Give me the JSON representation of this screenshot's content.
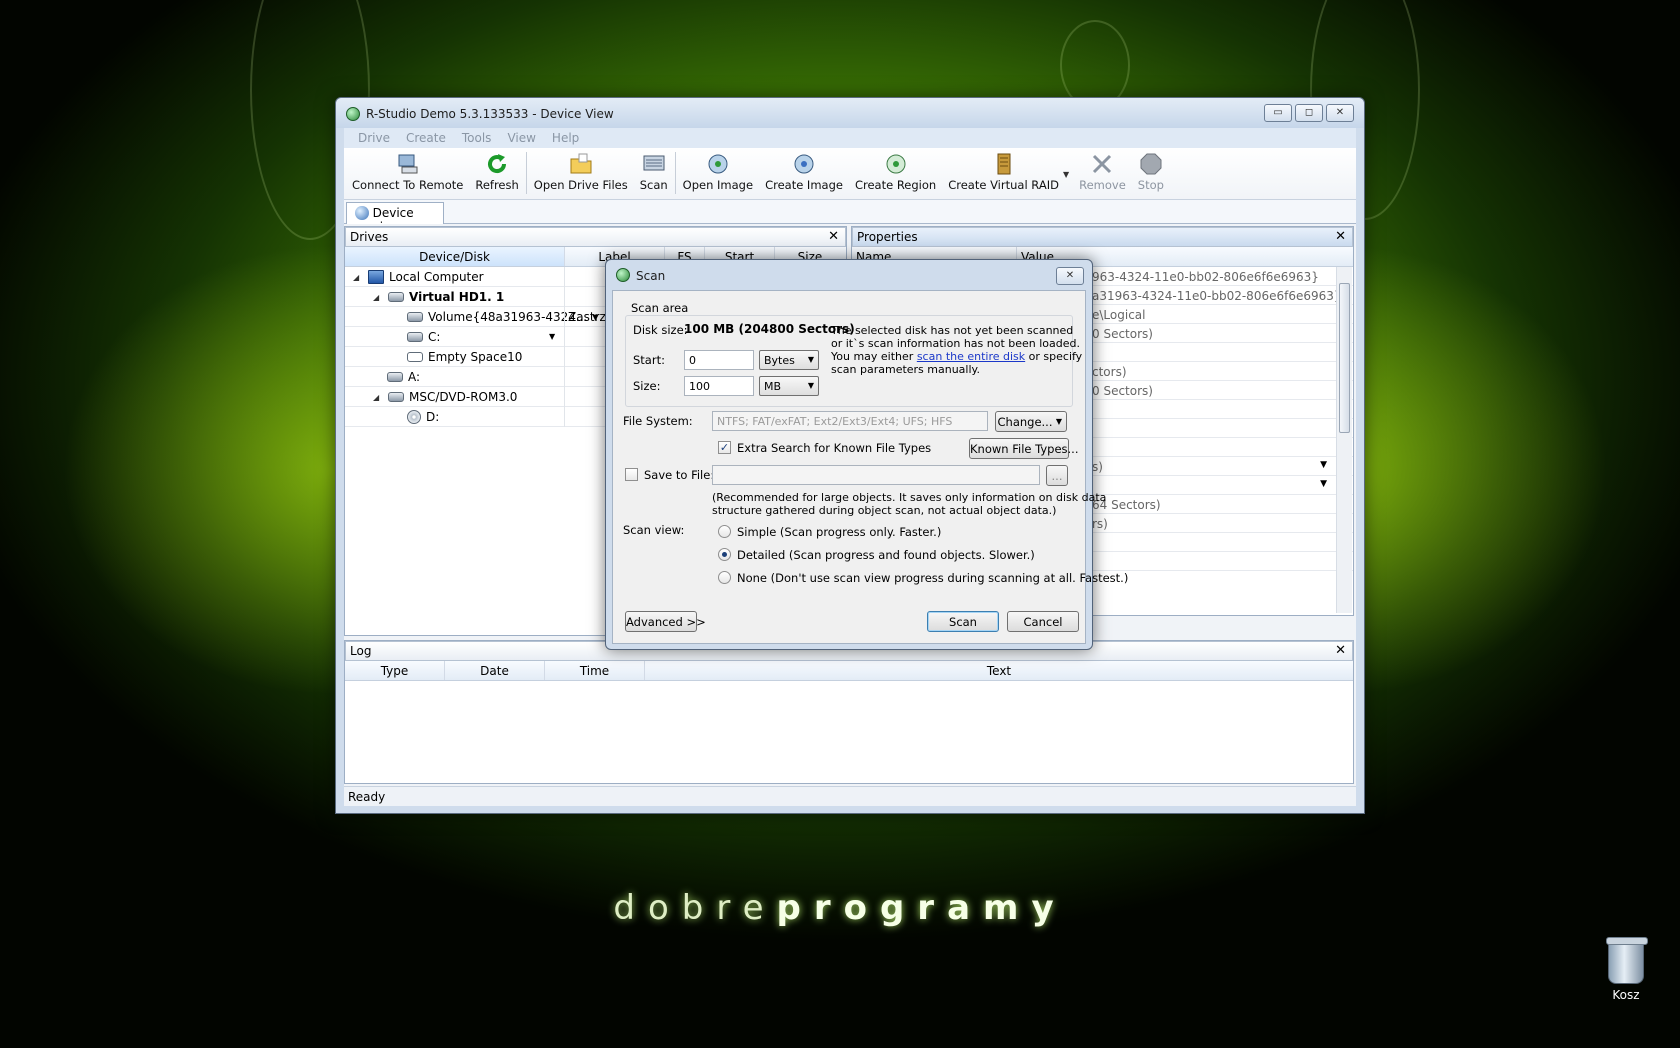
{
  "desktop": {
    "brand_light": "dobre",
    "brand_bold": "programy",
    "recycle_bin_label": "Kosz"
  },
  "window": {
    "title": "R-Studio Demo 5.3.133533 - Device View",
    "controls": [
      "▭",
      "◻",
      "✕"
    ]
  },
  "menu": [
    "Drive",
    "Create",
    "Tools",
    "View",
    "Help"
  ],
  "toolbar": {
    "connect": "Connect To Remote",
    "refresh": "Refresh",
    "open_drive_files": "Open Drive Files",
    "scan": "Scan",
    "open_image": "Open Image",
    "create_image": "Create Image",
    "create_region": "Create Region",
    "create_virtual_raid": "Create Virtual RAID",
    "remove": "Remove",
    "stop": "Stop"
  },
  "tab": {
    "device_view": "Device view"
  },
  "drives": {
    "header": "Drives",
    "close": "✕",
    "columns": [
      "Device/Disk",
      "Label",
      "FS",
      "Start",
      "Size"
    ],
    "rows": [
      {
        "name": "Local Computer",
        "label": ""
      },
      {
        "name": "Virtual HD1. 1",
        "label": ""
      },
      {
        "name": "Volume{48a31963-4324...",
        "label": "Zastrze"
      },
      {
        "name": "C:",
        "label": ""
      },
      {
        "name": "Empty Space10",
        "label": ""
      },
      {
        "name": "A:",
        "label": ""
      },
      {
        "name": "MSC/DVD-ROM3.0",
        "label": ""
      },
      {
        "name": "D:",
        "label": ""
      }
    ]
  },
  "properties": {
    "header": "Properties",
    "close": "✕",
    "columns": [
      "Name",
      "Value"
    ],
    "values": [
      "963-4324-11e0-bb02-806e6f6e6963}",
      "a31963-4324-11e0-bb02-806e6f6e6963}",
      "e\\Logical",
      "0 Sectors)",
      "",
      "ctors)",
      "0 Sectors)",
      "",
      "",
      "",
      "s)",
      "",
      "64 Sectors)",
      "rs)",
      "",
      ""
    ]
  },
  "log": {
    "header": "Log",
    "close": "✕",
    "columns": [
      "Type",
      "Date",
      "Time",
      "Text"
    ]
  },
  "status": "Ready",
  "dialog": {
    "title": "Scan",
    "close": "✕",
    "scan_area_label": "Scan area",
    "disk_size_label": "Disk size:",
    "disk_size_value": "100 MB (204800 Sectors)",
    "info_1": "The selected disk has not yet been scanned",
    "info_2": "or it`s scan information has not been loaded.",
    "info_3a": "You may either ",
    "info_link": "scan the entire disk",
    "info_3b": " or specify",
    "info_4": "scan parameters manually.",
    "start_label": "Start:",
    "start_value": "0",
    "start_unit": "Bytes",
    "size_label": "Size:",
    "size_value": "100",
    "size_unit": "MB",
    "fs_label": "File System:",
    "fs_value": "NTFS; FAT/exFAT; Ext2/Ext3/Ext4; UFS; HFS",
    "change_button": "Change...",
    "extra_search_label": "Extra Search for Known File Types",
    "known_types_button": "Known File Types...",
    "save_to_file_label": "Save to File:",
    "browse_button": "...",
    "recommend_1": "(Recommended for large objects. It saves only information on disk data",
    "recommend_2": "structure gathered during object scan, not actual object data.)",
    "scan_view_label": "Scan view:",
    "view_simple": "Simple (Scan progress only. Faster.)",
    "view_detailed": "Detailed (Scan progress and found objects. Slower.)",
    "view_none": "None (Don't use scan view progress during scanning at all. Fastest.)",
    "advanced_button": "Advanced >>",
    "scan_button": "Scan",
    "cancel_button": "Cancel"
  }
}
